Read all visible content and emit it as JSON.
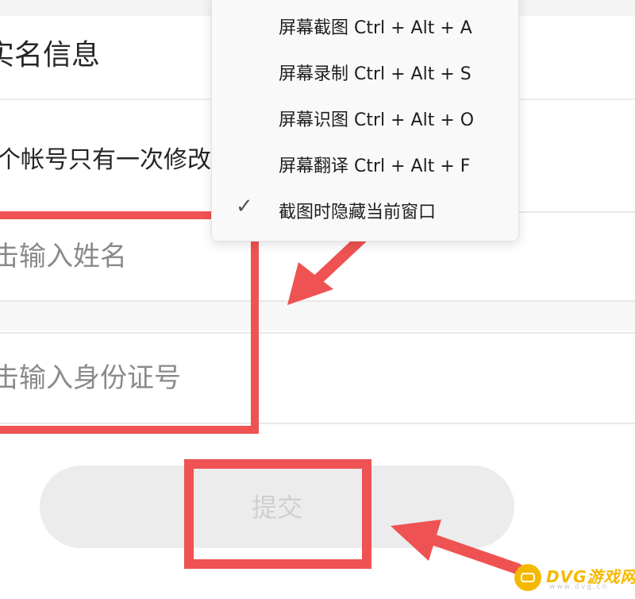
{
  "form": {
    "section_title": "实名信息",
    "hint": "个帐号只有一次修改",
    "name_placeholder": "击输入姓名",
    "id_placeholder": "击输入身份证号",
    "submit_label": "提交"
  },
  "context_menu": {
    "items": [
      {
        "label": "屏幕截图 Ctrl + Alt + A",
        "checked": false
      },
      {
        "label": "屏幕录制 Ctrl + Alt + S",
        "checked": false
      },
      {
        "label": "屏幕识图 Ctrl + Alt + O",
        "checked": false
      },
      {
        "label": "屏幕翻译 Ctrl + Alt + F",
        "checked": false
      },
      {
        "label": "截图时隐藏当前窗口",
        "checked": true
      }
    ],
    "check_glyph": "✓"
  },
  "watermark": {
    "brand": "DVG游戏网",
    "url": "www.dvg.cn"
  },
  "colors": {
    "highlight_red": "#ef5252",
    "brand_yellow": "#f5b800",
    "button_bg": "#ececec"
  },
  "icons": [
    "checkmark-icon",
    "dvg-logo-icon"
  ]
}
